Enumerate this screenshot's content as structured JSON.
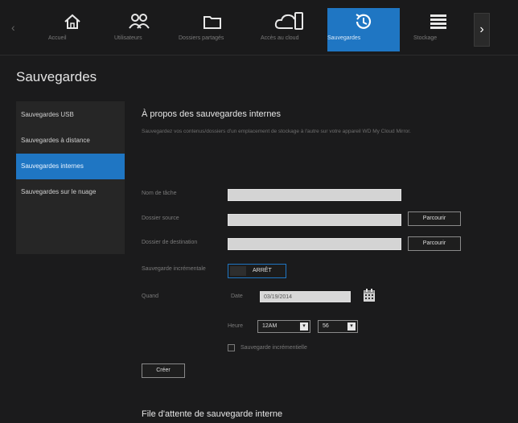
{
  "nav": {
    "items": [
      {
        "label": "Accueil",
        "icon": "home-icon"
      },
      {
        "label": "Utilisateurs",
        "icon": "users-icon"
      },
      {
        "label": "Dossiers partagés",
        "icon": "folder-icon"
      },
      {
        "label": "Accès au cloud",
        "icon": "cloud-device-icon"
      },
      {
        "label": "Sauvegardes",
        "icon": "backup-history-icon"
      },
      {
        "label": "Stockage",
        "icon": "storage-icon"
      }
    ],
    "left_arrow": "‹",
    "right_arrow": "›",
    "active_color": "#1f76c3"
  },
  "page_title": "Sauvegardes",
  "sidebar": {
    "items": [
      {
        "label": "Sauvegardes USB"
      },
      {
        "label": "Sauvegardes à distance"
      },
      {
        "label": "Sauvegardes internes"
      },
      {
        "label": "Sauvegardes sur le nuage"
      }
    ]
  },
  "main": {
    "section_title": "À propos des sauvegardes internes",
    "description": "Sauvegardez vos contenus/dossiers d'un emplacement de stockage à l'autre sur votre appareil WD My Cloud Mirror.",
    "form": {
      "task_name_label": "Nom de tâche",
      "source_folder_label": "Dossier source",
      "destination_folder_label": "Dossier de destination",
      "browse_label": "Parcourir",
      "incremental_label": "Sauvegarde incrémentale",
      "toggle_value": "ARRÊT",
      "schedule_label": "Quand",
      "date_label": "Date",
      "date_value": "03/19/2014",
      "hour_label": "Heure",
      "hour_value": "12AM",
      "minute_value": "56",
      "checkbox_label": "Sauvegarde incrémentielle",
      "create_label": "Créer"
    },
    "queue_title": "File d'attente de sauvegarde interne"
  }
}
